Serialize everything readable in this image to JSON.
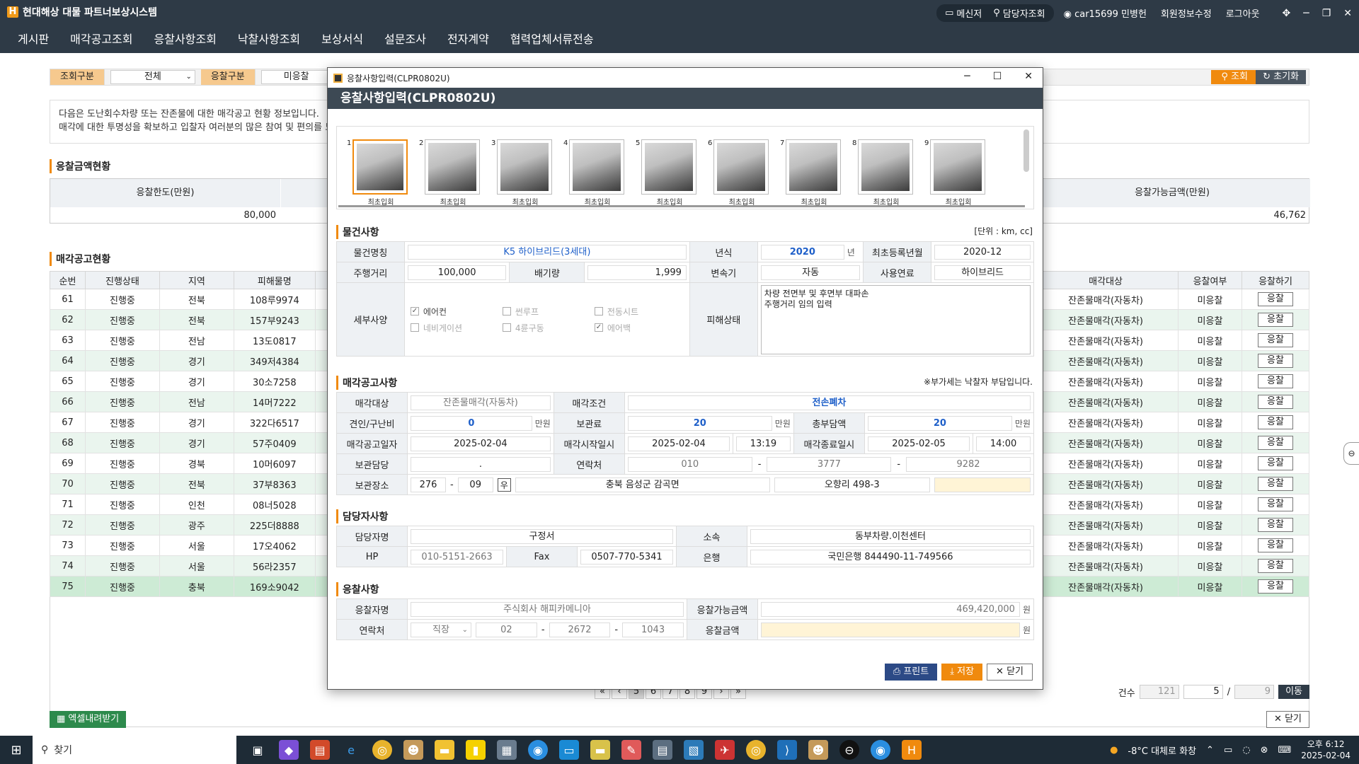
{
  "app": {
    "title": "현대해상 대물 파트너보상시스템",
    "logo_letter": "H",
    "top_actions": {
      "messenger": "메신저",
      "manager_lookup": "담당자조회",
      "user": "car15699 민병헌",
      "edit_member": "회원정보수정",
      "logout": "로그아웃"
    }
  },
  "nav": [
    "게시판",
    "매각공고조회",
    "응찰사항조회",
    "낙찰사항조회",
    "보상서식",
    "설문조사",
    "전자계약",
    "협력업체서류전송"
  ],
  "search": {
    "label1": "조회구분",
    "value1": "전체",
    "label2": "응찰구분",
    "value2": "미응찰",
    "search_btn": "조회",
    "reset_btn": "초기화"
  },
  "notice": {
    "line1": "다음은 도난회수차량 또는 잔존물에 대한 매각공고 현황 정보입니다.",
    "line2": "매각에 대한 투명성을 확보하고 입찰자 여러분의 많은 참여 및 편의를 도모"
  },
  "bid_summary": {
    "title": "응찰금액현황",
    "limit_label": "응찰한도(만원)",
    "limit_value": "80,000",
    "avail_label": "응찰가능금액(만원)",
    "avail_value": "46,762"
  },
  "list": {
    "title": "매각공고현황",
    "columns": [
      "순번",
      "진행상태",
      "지역",
      "피해물명",
      "매각대상",
      "응찰여부",
      "응찰하기"
    ],
    "rows": [
      [
        "61",
        "진행중",
        "전북",
        "108루9974",
        "잔존물매각(자동차)",
        "미응찰",
        "응찰"
      ],
      [
        "62",
        "진행중",
        "전북",
        "157부9243",
        "잔존물매각(자동차)",
        "미응찰",
        "응찰"
      ],
      [
        "63",
        "진행중",
        "전남",
        "13도0817",
        "잔존물매각(자동차)",
        "미응찰",
        "응찰"
      ],
      [
        "64",
        "진행중",
        "경기",
        "349저4384",
        "잔존물매각(자동차)",
        "미응찰",
        "응찰"
      ],
      [
        "65",
        "진행중",
        "경기",
        "30소7258",
        "잔존물매각(자동차)",
        "미응찰",
        "응찰"
      ],
      [
        "66",
        "진행중",
        "전남",
        "14머7222",
        "잔존물매각(자동차)",
        "미응찰",
        "응찰"
      ],
      [
        "67",
        "진행중",
        "경기",
        "322다6517",
        "잔존물매각(자동차)",
        "미응찰",
        "응찰"
      ],
      [
        "68",
        "진행중",
        "경기",
        "57주0409",
        "잔존물매각(자동차)",
        "미응찰",
        "응찰"
      ],
      [
        "69",
        "진행중",
        "경북",
        "10머6097",
        "잔존물매각(자동차)",
        "미응찰",
        "응찰"
      ],
      [
        "70",
        "진행중",
        "전북",
        "37부8363",
        "잔존물매각(자동차)",
        "미응찰",
        "응찰"
      ],
      [
        "71",
        "진행중",
        "인천",
        "08너5028",
        "잔존물매각(자동차)",
        "미응찰",
        "응찰"
      ],
      [
        "72",
        "진행중",
        "광주",
        "225더8888",
        "잔존물매각(자동차)",
        "미응찰",
        "응찰"
      ],
      [
        "73",
        "진행중",
        "서울",
        "17오4062",
        "잔존물매각(자동차)",
        "미응찰",
        "응찰"
      ],
      [
        "74",
        "진행중",
        "서울",
        "56라2357",
        "잔존물매각(자동차)",
        "미응찰",
        "응찰"
      ],
      [
        "75",
        "진행중",
        "충북",
        "169소9042",
        "잔존물매각(자동차)",
        "미응찰",
        "응찰"
      ]
    ],
    "excel_btn": "엑셀내려받기",
    "close_btn": "닫기",
    "pager": [
      "«",
      "‹",
      "5",
      "6",
      "7",
      "8",
      "9",
      "›",
      "»"
    ],
    "count_label": "건수",
    "count_total": "121",
    "page_current": "5",
    "page_sep": "/",
    "page_total": "9",
    "go_btn": "이동"
  },
  "modal": {
    "window_title": "응찰사항입력(CLPR0802U)",
    "header": "응찰사항입력(CLPR0802U)",
    "thumbnails": [
      {
        "num": "1",
        "cap": "최초입회"
      },
      {
        "num": "2",
        "cap": "최초입회"
      },
      {
        "num": "3",
        "cap": "최초입회"
      },
      {
        "num": "4",
        "cap": "최초입회"
      },
      {
        "num": "5",
        "cap": "최초입회"
      },
      {
        "num": "6",
        "cap": "최초입회"
      },
      {
        "num": "7",
        "cap": "최초입회"
      },
      {
        "num": "8",
        "cap": "최초입회"
      },
      {
        "num": "9",
        "cap": "최초입회"
      }
    ],
    "item": {
      "title": "물건사항",
      "unit_note": "[단위 : km, cc]",
      "name_label": "물건명칭",
      "name_value": "K5 하이브리드(3세대)",
      "year_label": "년식",
      "year_value": "2020",
      "year_unit": "년",
      "reg_label": "최초등록년월",
      "reg_value": "2020-12",
      "mileage_label": "주행거리",
      "mileage_value": "100,000",
      "cc_label": "배기량",
      "cc_value": "1,999",
      "trans_label": "변속기",
      "trans_value": "자동",
      "fuel_label": "사용연료",
      "fuel_value": "하이브리드",
      "spec_label": "세부사양",
      "options": [
        {
          "label": "에어컨",
          "checked": "✓",
          "enabled": true
        },
        {
          "label": "썬루프",
          "checked": "",
          "enabled": false
        },
        {
          "label": "전동시트",
          "checked": "",
          "enabled": false
        },
        {
          "label": "네비게이션",
          "checked": "",
          "enabled": false
        },
        {
          "label": "4륜구동",
          "checked": "",
          "enabled": false
        },
        {
          "label": "에어백",
          "checked": "✓",
          "enabled": false
        }
      ],
      "damage_label": "피해상태",
      "damage_value": "차량 전면부 및 후면부 대파손\n주행거리 임의 입력"
    },
    "sale": {
      "title": "매각공고사항",
      "vat_note": "※부가세는 낙찰자 부담입니다.",
      "target_label": "매각대상",
      "target_value": "잔존물매각(자동차)",
      "cond_label": "매각조건",
      "cond_value": "전손폐차",
      "tow_label": "견인/구난비",
      "tow_value": "0",
      "tow_unit": "만원",
      "storage_label": "보관료",
      "storage_value": "20",
      "storage_unit": "만원",
      "total_label": "총부담액",
      "total_value": "20",
      "total_unit": "만원",
      "notice_label": "매각공고일자",
      "notice_value": "2025-02-04",
      "start_label": "매각시작일시",
      "start_date": "2025-02-04",
      "start_time": "13:19",
      "end_label": "매각종료일시",
      "end_date": "2025-02-05",
      "end_time": "14:00",
      "keeper_label": "보관담당",
      "keeper_value": ".",
      "contact_label": "연락처",
      "contact_1": "010",
      "contact_2": "3777",
      "contact_3": "9282",
      "place_label": "보관장소",
      "zip_1": "276",
      "zip_2": "09",
      "zip_btn": "우",
      "addr_1": "충북 음성군 감곡면",
      "addr_2": "오향리 498-3",
      "addr_3": ""
    },
    "manager": {
      "title": "담당자사항",
      "name_label": "담당자명",
      "name_value": "구정서",
      "dept_label": "소속",
      "dept_value": "동부차량.이천센터",
      "hp_label": "HP",
      "hp_value": "010-5151-2663",
      "fax_label": "Fax",
      "fax_value": "0507-770-5341",
      "bank_label": "은행",
      "bank_value": "국민은행 844490-11-749566"
    },
    "bid": {
      "title": "응찰사항",
      "bidder_label": "응찰자명",
      "bidder_value": "주식회사 해피카메니아",
      "avail_label": "응찰가능금액",
      "avail_value": "469,420,000",
      "avail_unit": "원",
      "contact_label": "연락처",
      "contact_type": "직장",
      "contact_1": "02",
      "contact_2": "2672",
      "contact_3": "1043",
      "amount_label": "응찰금액",
      "amount_value": "",
      "amount_unit": "원"
    },
    "buttons": {
      "print": "프린트",
      "save": "저장",
      "close": "닫기"
    }
  },
  "taskbar": {
    "search_placeholder": "찾기",
    "weather": "-8°C 대체로 화창",
    "time": "오후 6:12",
    "date": "2025-02-04"
  }
}
